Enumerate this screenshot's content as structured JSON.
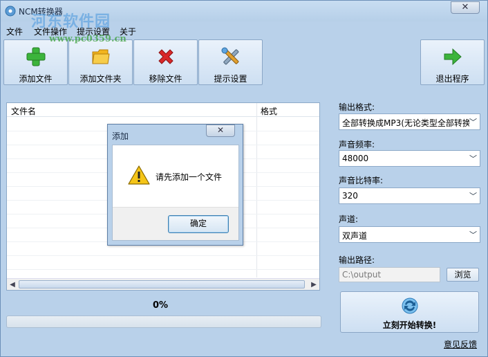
{
  "window": {
    "title": "NCM转换器",
    "close_glyph": "✕"
  },
  "watermark": {
    "text": "河东软件园",
    "url": "www.pc0359.cn"
  },
  "menu": [
    "文件",
    "文件操作",
    "提示设置",
    "关于"
  ],
  "toolbar": {
    "add_file": {
      "label": "添加文件",
      "icon": "add-icon",
      "color": "#3cb43c"
    },
    "add_folder": {
      "label": "添加文件夹",
      "icon": "folder-icon",
      "color": "#f2b51e"
    },
    "remove_file": {
      "label": "移除文件",
      "icon": "remove-icon",
      "color": "#d8282a"
    },
    "settings": {
      "label": "提示设置",
      "icon": "tools-icon"
    },
    "exit": {
      "label": "退出程序",
      "icon": "exit-arrow-icon",
      "color": "#3cb43c"
    }
  },
  "file_list": {
    "columns": [
      "文件名",
      "格式"
    ],
    "rows": []
  },
  "progress": {
    "percent_text": "0%",
    "value": 0
  },
  "settings_panel": {
    "output_format": {
      "label": "输出格式:",
      "value": "全部转换成MP3(无论类型全部转换"
    },
    "sample_rate": {
      "label": "声音频率:",
      "value": "48000"
    },
    "bitrate": {
      "label": "声音比特率:",
      "value": "320"
    },
    "channels": {
      "label": "声道:",
      "value": "双声道"
    },
    "output_path": {
      "label": "输出路径:",
      "value": "C:\\output"
    },
    "browse_label": "浏览",
    "start_label": "立刻开始转换!",
    "feedback_label": "意见反馈"
  },
  "dialog": {
    "title": "添加",
    "close_glyph": "✕",
    "message": "请先添加一个文件",
    "ok_label": "确定",
    "icon": "warning-icon"
  }
}
